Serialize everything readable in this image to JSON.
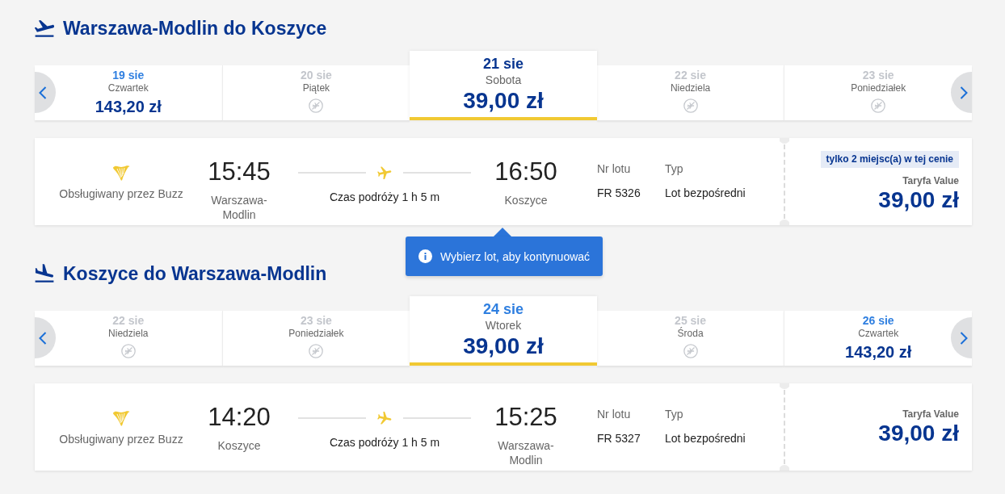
{
  "sections": [
    {
      "kind": "outbound",
      "title": "Warszawa-Modlin do Koszyce",
      "dates": [
        {
          "date": "19 sie",
          "day": "Czwartek",
          "price": "143,20 zł",
          "available": true,
          "selected": false,
          "color": "#2f7fe0"
        },
        {
          "date": "20 sie",
          "day": "Piątek",
          "available": false,
          "selected": false,
          "color": "#c3c6cc"
        },
        {
          "date": "21 sie",
          "day": "Sobota",
          "price": "39,00 zł",
          "available": true,
          "selected": true,
          "color": "#073590"
        },
        {
          "date": "22 sie",
          "day": "Niedziela",
          "available": false,
          "selected": false,
          "color": "#c3c6cc"
        },
        {
          "date": "23 sie",
          "day": "Poniedziałek",
          "available": false,
          "selected": false,
          "color": "#c3c6cc"
        }
      ],
      "flight": {
        "operator": "Obsługiwany przez Buzz",
        "departure_time": "15:45",
        "departure_city": "Warszawa-Modlin",
        "duration": "Czas podróży 1 h 5 m",
        "arrival_time": "16:50",
        "arrival_city": "Koszyce",
        "flight_number_label": "Nr lotu",
        "flight_number": "FR 5326",
        "type_label": "Typ",
        "type": "Lot bezpośredni",
        "seat_notice": "tylko 2 miejsc(a) w tej cenie",
        "fare_name": "Taryfa Value",
        "price": "39,00 zł"
      }
    },
    {
      "kind": "inbound",
      "title": "Koszyce do Warszawa-Modlin",
      "dates": [
        {
          "date": "22 sie",
          "day": "Niedziela",
          "available": false,
          "selected": false,
          "color": "#c3c6cc"
        },
        {
          "date": "23 sie",
          "day": "Poniedziałek",
          "available": false,
          "selected": false,
          "color": "#c3c6cc"
        },
        {
          "date": "24 sie",
          "day": "Wtorek",
          "price": "39,00 zł",
          "available": true,
          "selected": true,
          "color": "#2f7fe0"
        },
        {
          "date": "25 sie",
          "day": "Środa",
          "available": false,
          "selected": false,
          "color": "#c3c6cc"
        },
        {
          "date": "26 sie",
          "day": "Czwartek",
          "price": "143,20 zł",
          "available": true,
          "selected": false,
          "color": "#2f7fe0"
        }
      ],
      "flight": {
        "operator": "Obsługiwany przez Buzz",
        "departure_time": "14:20",
        "departure_city": "Koszyce",
        "duration": "Czas podróży 1 h 5 m",
        "arrival_time": "15:25",
        "arrival_city": "Warszawa-Modlin",
        "flight_number_label": "Nr lotu",
        "flight_number": "FR 5327",
        "type_label": "Typ",
        "type": "Lot bezpośredni",
        "fare_name": "Taryfa Value",
        "price": "39,00 zł"
      }
    }
  ],
  "tooltip": {
    "text": "Wybierz lot, aby kontynuować"
  }
}
